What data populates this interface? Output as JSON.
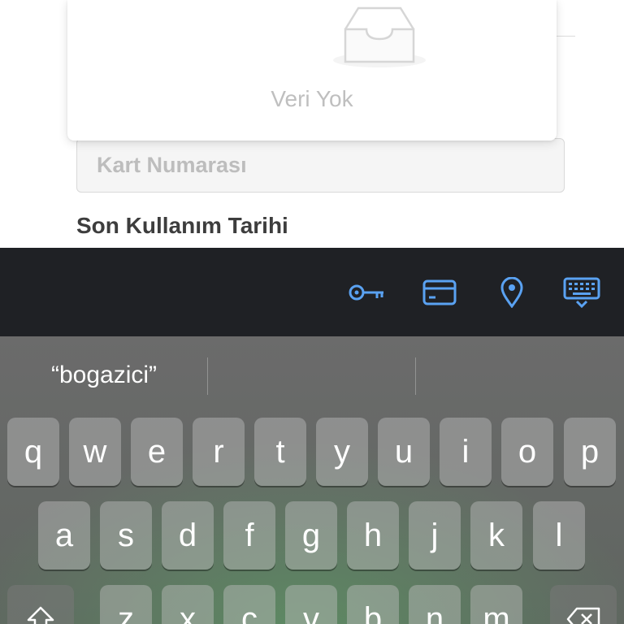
{
  "dropdown": {
    "empty_icon": "inbox-tray-icon",
    "empty_text": "Veri Yok"
  },
  "form": {
    "card_number_placeholder": "Kart Numarası",
    "expiry_label": "Son Kullanım Tarihi"
  },
  "accessory_bar": {
    "icons": [
      "key-icon",
      "credit-card-icon",
      "location-pin-icon",
      "keyboard-hide-icon"
    ],
    "icon_color": "#5aa2f2"
  },
  "suggestions": [
    "“bogazici”",
    "",
    ""
  ],
  "keyboard": {
    "row1": [
      "q",
      "w",
      "e",
      "r",
      "t",
      "y",
      "u",
      "i",
      "o",
      "p"
    ],
    "row2": [
      "a",
      "s",
      "d",
      "f",
      "g",
      "h",
      "j",
      "k",
      "l"
    ],
    "row3": [
      "z",
      "x",
      "c",
      "v",
      "b",
      "n",
      "m"
    ],
    "shift_icon": "shift-icon",
    "delete_icon": "backspace-icon"
  }
}
